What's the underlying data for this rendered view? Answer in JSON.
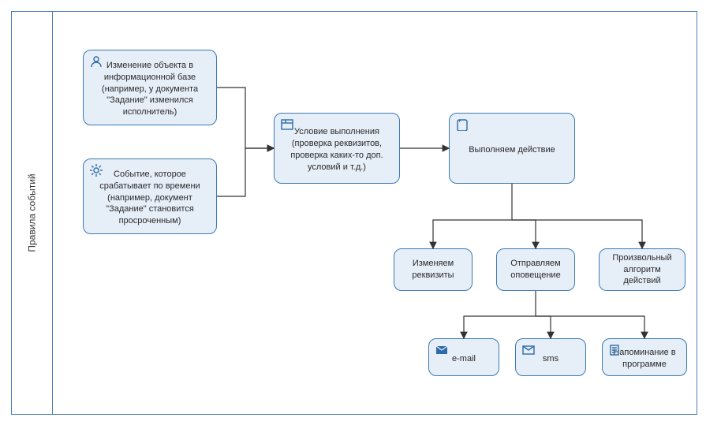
{
  "lane": {
    "title": "Правила событий"
  },
  "nodes": {
    "change": {
      "text": "Изменение объекта в информационной базе (например, у документа \"Задание\" изменился исполнитель)",
      "icon": "person-icon"
    },
    "event": {
      "text": "Событие, которое срабатывает по времени (например, документ \"Задание\" становится просроченным)",
      "icon": "gear-icon"
    },
    "condition": {
      "text": "Условие выполнения (проверка реквизитов, проверка каких-то доп. условий и т.д.)",
      "icon": "form-icon"
    },
    "action": {
      "text": "Выполняем действие",
      "icon": "script-icon"
    },
    "requisites": {
      "text": "Изменяем реквизиты",
      "icon": null
    },
    "notify": {
      "text": "Отправляем оповещение",
      "icon": null
    },
    "custom_alg": {
      "text": "Произвольный алгоритм действий",
      "icon": null
    },
    "email": {
      "text": "e-mail",
      "icon": "mail-filled-icon"
    },
    "sms": {
      "text": "sms",
      "icon": "mail-outline-icon"
    },
    "reminder": {
      "text": "Напоминание в программе",
      "icon": "note-icon"
    }
  },
  "chart_data": {
    "type": "flowchart",
    "edges": [
      [
        "change",
        "condition"
      ],
      [
        "event",
        "condition"
      ],
      [
        "condition",
        "action"
      ],
      [
        "action",
        "requisites"
      ],
      [
        "action",
        "notify"
      ],
      [
        "action",
        "custom_alg"
      ],
      [
        "notify",
        "email"
      ],
      [
        "notify",
        "sms"
      ],
      [
        "notify",
        "reminder"
      ]
    ]
  }
}
